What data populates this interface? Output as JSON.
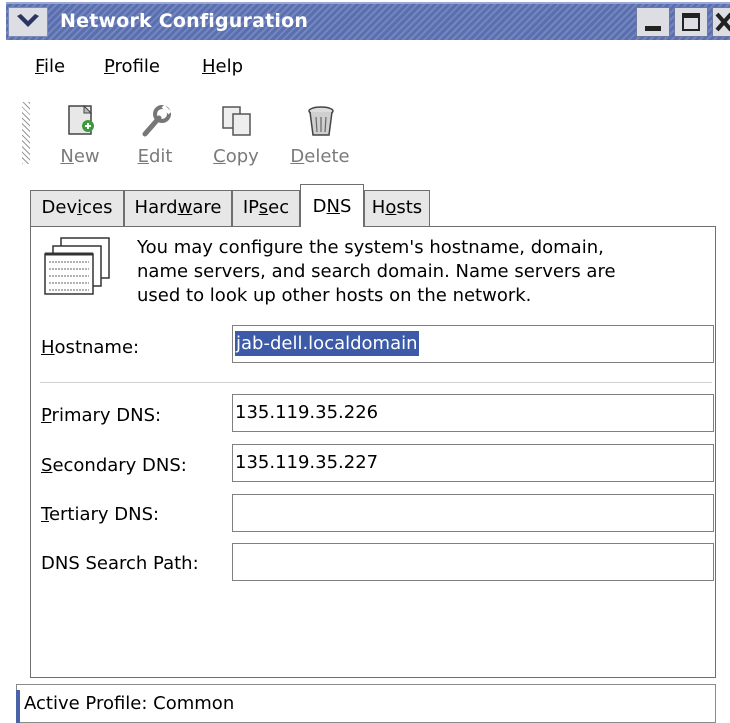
{
  "window": {
    "title": "Network Configuration"
  },
  "menubar": {
    "items": [
      {
        "pre": "",
        "key": "F",
        "post": "ile"
      },
      {
        "pre": "",
        "key": "P",
        "post": "rofile"
      },
      {
        "pre": "",
        "key": "H",
        "post": "elp"
      }
    ]
  },
  "toolbar": {
    "items": [
      {
        "pre": "",
        "key": "N",
        "post": "ew",
        "icon": "new-icon"
      },
      {
        "pre": "",
        "key": "E",
        "post": "dit",
        "icon": "edit-icon"
      },
      {
        "pre": "",
        "key": "C",
        "post": "opy",
        "icon": "copy-icon"
      },
      {
        "pre": "",
        "key": "D",
        "post": "elete",
        "icon": "delete-icon"
      }
    ]
  },
  "tabs": [
    {
      "pre": "Dev",
      "key": "i",
      "post": "ces"
    },
    {
      "pre": "Hard",
      "key": "w",
      "post": "are"
    },
    {
      "pre": "IP",
      "key": "s",
      "post": "ec"
    },
    {
      "pre": "D",
      "key": "N",
      "post": "S"
    },
    {
      "pre": "H",
      "key": "o",
      "post": "sts"
    }
  ],
  "active_tab": "DNS",
  "dns": {
    "info_lines": [
      "You may configure the system's hostname, domain,",
      "name servers, and search domain. Name servers are",
      "used to look up other hosts on the network."
    ],
    "hostname": {
      "pre": "",
      "key": "H",
      "post": "ostname:",
      "value": "jab-dell.localdomain"
    },
    "primary": {
      "pre": "",
      "key": "P",
      "post": "rimary DNS:",
      "value": "135.119.35.226"
    },
    "secondary": {
      "pre": "",
      "key": "S",
      "post": "econdary DNS:",
      "value": "135.119.35.227"
    },
    "tertiary": {
      "pre": "",
      "key": "T",
      "post": "ertiary DNS:",
      "value": ""
    },
    "search_path": {
      "label": "DNS Search Path:",
      "value": ""
    }
  },
  "status": {
    "text": "Active Profile: Common"
  }
}
